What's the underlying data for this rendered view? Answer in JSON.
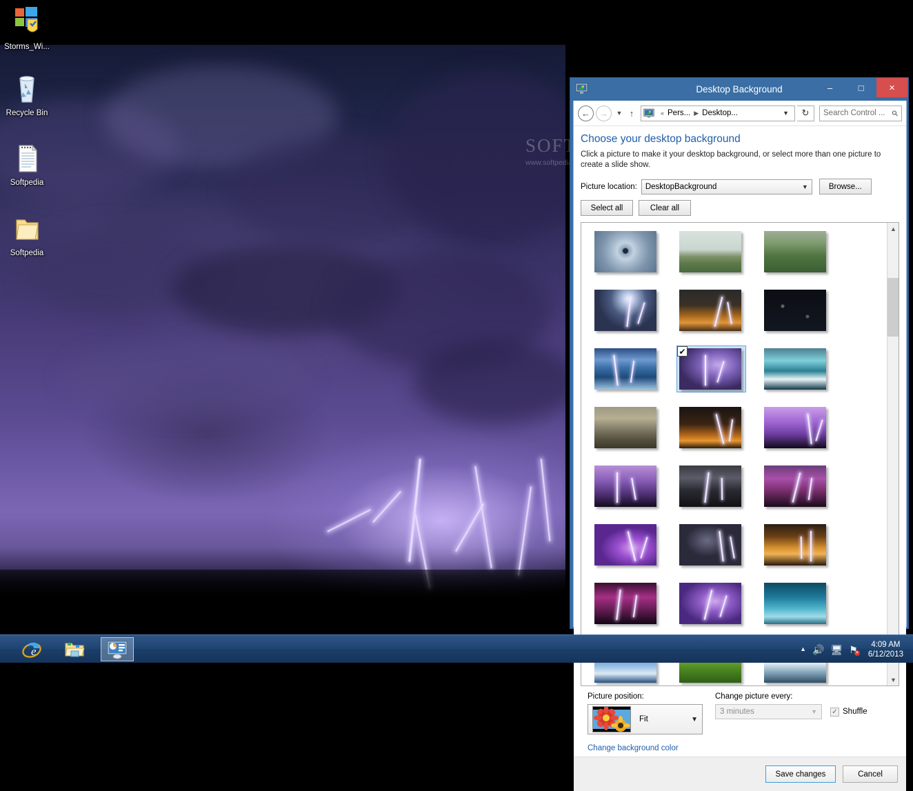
{
  "desktop": {
    "icons": [
      {
        "label": "Storms_Wi...",
        "icon": "windows-theme-icon"
      },
      {
        "label": "Recycle Bin",
        "icon": "recycle-bin-icon"
      },
      {
        "label": "Softpedia",
        "icon": "text-document-icon"
      },
      {
        "label": "Softpedia",
        "icon": "folder-icon"
      }
    ],
    "watermark": {
      "brand": "SOFTPEDIA",
      "url": "www.softpedia.com"
    }
  },
  "taskbar": {
    "buttons": [
      {
        "name": "internet-explorer",
        "label": "Internet Explorer",
        "active": false
      },
      {
        "name": "file-explorer",
        "label": "File Explorer",
        "active": false
      },
      {
        "name": "control-panel-display",
        "label": "Desktop Background",
        "active": true
      }
    ],
    "tray": {
      "show_hidden_icons": "show-hidden-icons-icon",
      "volume": "speaker-icon",
      "network": "network-icon",
      "action_center": "flag-problem-icon",
      "time": "4:09 AM",
      "date": "6/12/2013"
    }
  },
  "window": {
    "title": "Desktop Background",
    "title_icon": "display-monitor-icon",
    "controls": {
      "minimize": "–",
      "maximize": "□",
      "close": "×"
    },
    "addressbar": {
      "back": "back-icon",
      "forward": "forward-icon",
      "history": "recent-locations-icon",
      "up": "up-one-level-icon",
      "crumb_icon": "display-monitor-icon",
      "crumb_prefix": "«",
      "crumbs": [
        "Pers...",
        "Desktop..."
      ],
      "dropdown": "chevron-down-icon",
      "refresh": "refresh-icon",
      "search_placeholder": "Search Control ...",
      "search_value": "",
      "search_icon": "search-icon"
    },
    "page": {
      "title": "Choose your desktop background",
      "description": "Click a picture to make it your desktop background, or select more than one picture to create a slide show.",
      "location_label": "Picture location:",
      "location_value": "DesktopBackground",
      "browse_label": "Browse...",
      "select_all_label": "Select all",
      "clear_all_label": "Clear all"
    },
    "thumbnails": [
      {
        "id": 1,
        "alt": "hurricane-from-space",
        "selected": false
      },
      {
        "id": 2,
        "alt": "palm-trees-in-wind",
        "selected": false
      },
      {
        "id": 3,
        "alt": "rain-on-pine-forest",
        "selected": false
      },
      {
        "id": 4,
        "alt": "lightning-burst-over-bay",
        "selected": false
      },
      {
        "id": 5,
        "alt": "storm-cloud-at-sunset",
        "selected": false
      },
      {
        "id": 6,
        "alt": "heavy-rain-drops-dark",
        "selected": false
      },
      {
        "id": 7,
        "alt": "lightning-over-blue-sea",
        "selected": false
      },
      {
        "id": 8,
        "alt": "purple-lightning-city",
        "selected": true
      },
      {
        "id": 9,
        "alt": "ocean-wave-crashing",
        "selected": false
      },
      {
        "id": 10,
        "alt": "supercell-shelf-cloud",
        "selected": false
      },
      {
        "id": 11,
        "alt": "lightning-orange-horizon",
        "selected": false
      },
      {
        "id": 12,
        "alt": "lightning-over-cactus",
        "selected": false
      },
      {
        "id": 13,
        "alt": "violet-lightning-field",
        "selected": false
      },
      {
        "id": 14,
        "alt": "white-lightning-night",
        "selected": false
      },
      {
        "id": 15,
        "alt": "magenta-lightning-bolt",
        "selected": false
      },
      {
        "id": 16,
        "alt": "purple-sky-lightning",
        "selected": false
      },
      {
        "id": 17,
        "alt": "lone-lightning-dark-sky",
        "selected": false
      },
      {
        "id": 18,
        "alt": "sunset-storm-lightning",
        "selected": false
      },
      {
        "id": 19,
        "alt": "pink-lightning-branches",
        "selected": false
      },
      {
        "id": 20,
        "alt": "violet-cloud-lightning",
        "selected": false
      },
      {
        "id": 21,
        "alt": "calm-teal-ocean",
        "selected": false
      },
      {
        "id": 22,
        "alt": "lighthouse-in-storm",
        "selected": false
      },
      {
        "id": 23,
        "alt": "red-tulips-in-rain",
        "selected": false
      },
      {
        "id": 24,
        "alt": "sea-foam-on-rocks",
        "selected": false
      }
    ],
    "scrollbar": {
      "up": "scroll-up-icon",
      "down": "scroll-down-icon"
    },
    "options": {
      "position_label": "Picture position:",
      "position_value": "Fit",
      "position_preview": "flowers-fit-preview",
      "interval_label": "Change picture every:",
      "interval_value": "3 minutes",
      "interval_disabled": true,
      "shuffle_label": "Shuffle",
      "shuffle_checked": true,
      "change_color_link": "Change background color"
    },
    "footer": {
      "save_label": "Save changes",
      "cancel_label": "Cancel"
    }
  },
  "colors": {
    "titlebar": "#3a6ea5",
    "close_button": "#d64e4e",
    "link": "#1f5faa",
    "selection": "#cce4f7",
    "selection_border": "#6ba5d8",
    "taskbar": "#1f4573"
  }
}
